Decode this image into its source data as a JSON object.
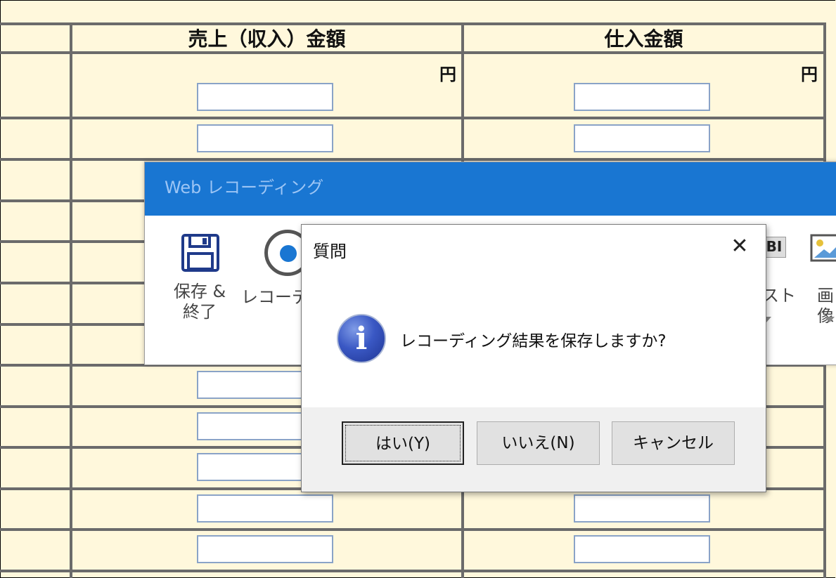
{
  "sheet": {
    "headers": [
      "売上（収入）金額",
      "仕入金額"
    ],
    "unit": "円"
  },
  "recording_window": {
    "title": "Web レコーディング",
    "tools": [
      {
        "label": "保存 &\n終了",
        "icon": "floppy-disk-icon"
      },
      {
        "label": "レコーディ",
        "icon": "record-icon"
      },
      {
        "label": "スト",
        "icon": "text-icon"
      },
      {
        "label": "画像",
        "icon": "image-icon"
      }
    ]
  },
  "dialog": {
    "title": "質問",
    "message": "レコーディング結果を保存しますか?",
    "icon": "info-icon",
    "buttons": {
      "yes": "はい(Y)",
      "no": "いいえ(N)",
      "cancel": "キャンセル"
    }
  }
}
